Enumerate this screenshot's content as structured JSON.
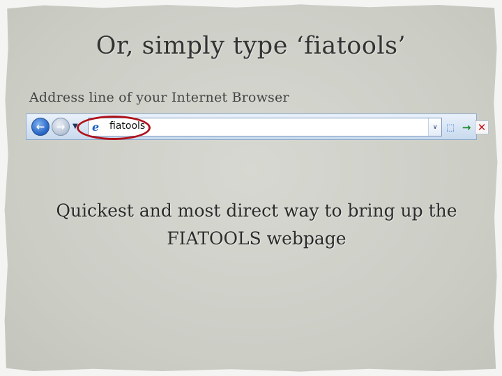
{
  "slide": {
    "title": "Or, simply type ‘fiatools’",
    "caption": "Address line of your Internet Browser",
    "body_line1": "Quickest and most direct way to bring up the",
    "body_line2": "FIATOOLS webpage"
  },
  "browser": {
    "address_value": "fiatools",
    "icons": {
      "back": "back-arrow-icon",
      "forward": "forward-arrow-icon",
      "history": "history-dropdown-icon",
      "site": "internet-explorer-icon",
      "dropdown": "chevron-down-icon",
      "compat": "compatibility-view-icon",
      "go": "go-arrow-icon",
      "stop": "stop-x-icon"
    },
    "glyphs": {
      "back": "←",
      "forward": "→",
      "history": "▼",
      "site": "e",
      "dropdown": "∨",
      "compat": "⬚",
      "go": "→",
      "stop": "✕"
    },
    "highlight_color": "#b0121a"
  }
}
